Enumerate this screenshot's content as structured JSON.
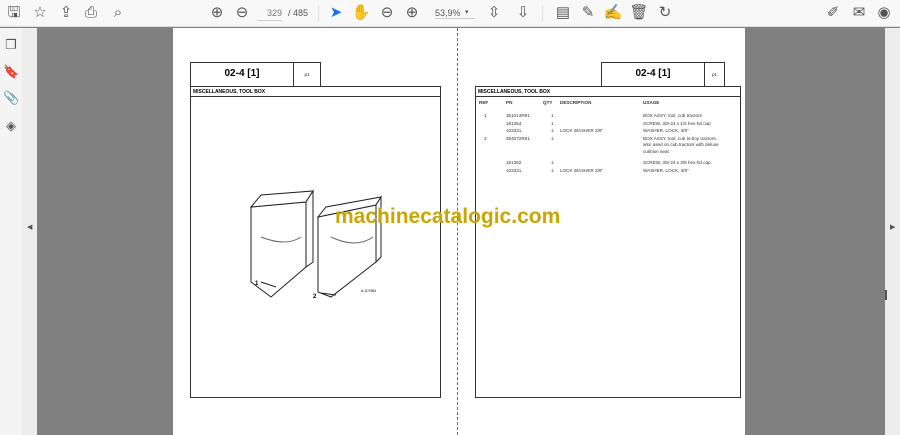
{
  "toolbar": {
    "current_page": "329",
    "total_pages": "/ 485",
    "zoom": "53,9%",
    "icons": [
      "save-icon",
      "star-icon",
      "upload-icon",
      "print-icon",
      "search-icon",
      "page-up-icon",
      "page-down-icon",
      "select-cursor-icon",
      "hand-icon",
      "zoom-out-icon",
      "zoom-in-icon",
      "fit-page-icon",
      "scroll-mode-icon",
      "comment-icon",
      "highlight-icon",
      "sign-icon",
      "delete-icon",
      "rotate-icon",
      "share-icon",
      "email-icon",
      "account-icon"
    ]
  },
  "sidebar": {
    "icons": [
      "pages-icon",
      "bookmark-icon",
      "attachment-icon",
      "layers-icon"
    ]
  },
  "left_page": {
    "title": "02-4 [1]",
    "page_ref": "p1",
    "section": "MISCELLANEOUS, TOOL BOX",
    "callouts": [
      "1",
      "2"
    ],
    "figure_code": "A-107963"
  },
  "right_page": {
    "title": "02-4 [1]",
    "page_ref": "p1",
    "section": "MISCELLANEOUS, TOOL BOX",
    "columns": [
      "REF",
      "PN",
      "QTY",
      "DESCRIPTION",
      "USAGE"
    ],
    "rows": [
      {
        "ref": "1",
        "pn": "351014R91",
        "qty": "1",
        "desc": "",
        "usage": [
          "BOX ASSY, tool, cub tractors"
        ]
      },
      {
        "ref": "",
        "pn": "181354",
        "qty": "1",
        "desc": "",
        "usage": [
          "SCREW, 3/8-24 x 1/2 hex-hd cap"
        ]
      },
      {
        "ref": "",
        "pn": "103321",
        "qty": "1",
        "desc": "LOCK WASHER 3/8\"",
        "usage": [
          "WASHER, LOCK, 3/8\""
        ]
      },
      {
        "ref": "2",
        "pn": "364072R91",
        "qty": "1",
        "desc": "",
        "usage": [
          "BOX ASSY, tool, cub lo-boy tractors,",
          "also used on cub tractors with deluxe",
          "cushion seat"
        ]
      },
      {
        "ref": "",
        "pn": "181352",
        "qty": "1",
        "desc": "",
        "usage": [
          "SCREW, 3/8-24 x 3/8 hex-hd cap"
        ]
      },
      {
        "ref": "",
        "pn": "103321",
        "qty": "1",
        "desc": "LOCK WASHER 3/8\"",
        "usage": [
          "WASHER, LOCK, 3/8\""
        ]
      }
    ]
  },
  "watermark": "machinecatalogic.com"
}
